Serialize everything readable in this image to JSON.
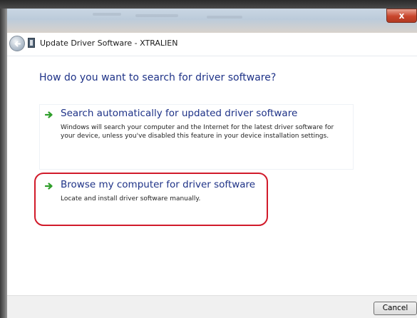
{
  "window": {
    "title": "Update Driver Software - XTRALIEN",
    "close_glyph": "x"
  },
  "main": {
    "question": "How do you want to search for driver software?",
    "options": [
      {
        "title": "Search automatically for updated driver software",
        "description": "Windows will search your computer and the Internet for the latest driver software for your device, unless you've disabled this feature in your device installation settings.",
        "icon": "green-arrow-icon"
      },
      {
        "title": "Browse my computer for driver software",
        "description": "Locate and install driver software manually.",
        "icon": "green-arrow-icon",
        "highlighted": true
      }
    ]
  },
  "footer": {
    "cancel_label": "Cancel"
  },
  "colors": {
    "link_blue": "#1e3287",
    "highlight_red": "#d11a2a",
    "arrow_green": "#2e9e2a",
    "close_red": "#c8452c"
  }
}
